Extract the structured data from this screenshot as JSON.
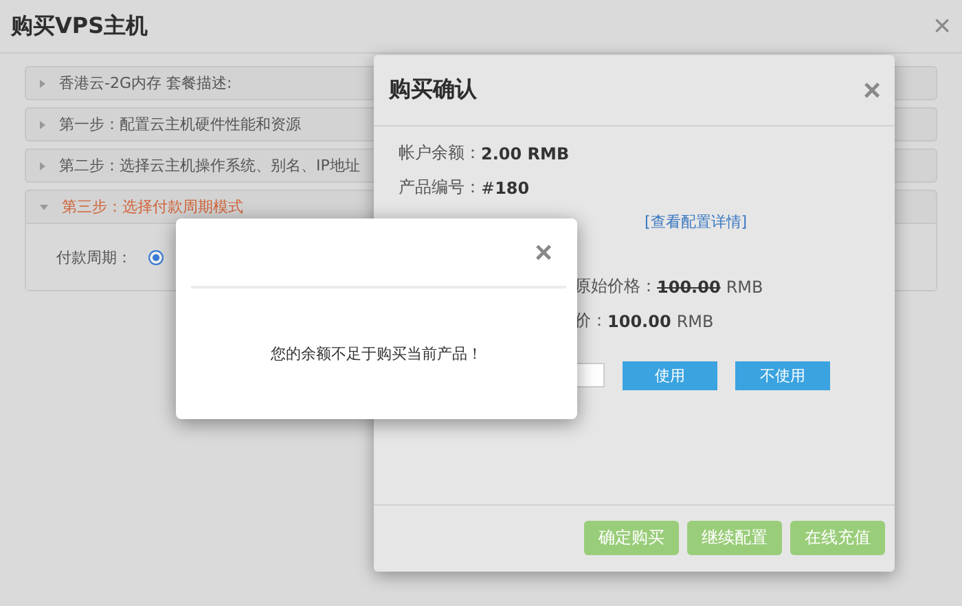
{
  "page": {
    "title": "购买VPS主机",
    "close": "×"
  },
  "sections": [
    {
      "title": "香港云-2G内存 套餐描述:",
      "expanded": false
    },
    {
      "title": "第一步：配置云主机硬件性能和资源",
      "expanded": false
    },
    {
      "title": "第二步：选择云主机操作系统、别名、IP地址",
      "expanded": false
    },
    {
      "title": "第三步：选择付款周期模式",
      "expanded": true,
      "field_label": "付款周期：",
      "options": [
        {
          "selected": true
        }
      ]
    }
  ],
  "confirm_dialog": {
    "title": "购买确认",
    "close": "×",
    "rows": [
      {
        "kind": "info",
        "label": "帐户余额：",
        "value": "**2.00 RMB**"
      },
      {
        "kind": "info",
        "label": "产品编号：",
        "value": "#**180**"
      },
      {
        "kind": "link",
        "link": "[查看配置详情]"
      },
      {
        "kind": "price",
        "label": "原始价格：",
        "amount": "100.00",
        "unit": "RMB",
        "struck": true
      },
      {
        "kind": "price",
        "label": "价：",
        "amount": "100.00",
        "unit": "RMB",
        "struck": false
      },
      {
        "kind": "coupon",
        "buttons": [
          "使用",
          "不使用"
        ]
      }
    ],
    "buttons": [
      "确定购买",
      "继续配置",
      "在线充值"
    ]
  },
  "alert": {
    "close": "×",
    "message": "您的余额不足于购买当前产品！"
  }
}
